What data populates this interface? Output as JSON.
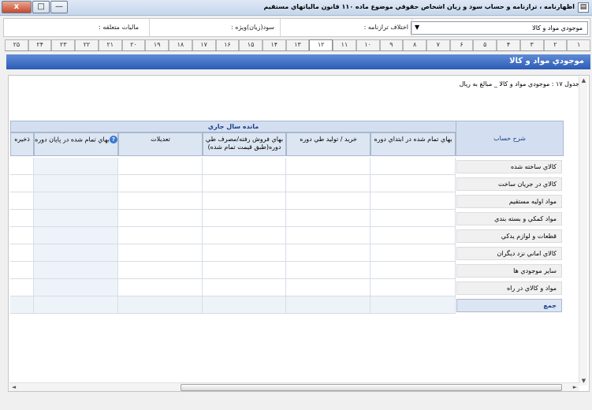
{
  "window": {
    "title": "اظهارنامه ، ترازنامه و حساب سود و زيان اشخاص حقوقي موضوع ماده ۱۱۰ قانون مالياتهاي مستقيم",
    "controls": {
      "close": "x",
      "maximize": "□",
      "minimize": "—"
    }
  },
  "toolbar": {
    "select_value": "موجودي مواد و كالا",
    "difference_label": "اختلاف ترازنامه :",
    "profit_label": "سود(زيان)ويژه :",
    "tax_label": "ماليات متعلقه :"
  },
  "tabs": [
    "۱",
    "۲",
    "۳",
    "۴",
    "۵",
    "۶",
    "۷",
    "۸",
    "۹",
    "۱۰",
    "۱۱",
    "۱۲",
    "۱۳",
    "۱۴",
    "۱۵",
    "۱۶",
    "۱۷",
    "۱۸",
    "۱۹",
    "۲۰",
    "۲۱",
    "۲۲",
    "۲۳",
    "۲۴",
    "۲۵"
  ],
  "active_tab": "۱۲",
  "section": {
    "title": "موجودي مواد و كالا"
  },
  "table": {
    "caption": "جدول ۱۷ : موجودي مواد و كالا _ مبالغ به ريال",
    "group_header": "مانده سال جاري",
    "row_header": "شرح حساب",
    "columns": [
      "بهاي تمام شده در ابتداي دوره",
      "خريد / توليد طي دوره",
      "بهاي فروش رفته/مصرف طي دوره(طبق قيمت تمام شده)",
      "تعديلات",
      "بهاي تمام شده در پايان دوره",
      "ذخيره"
    ],
    "rows": [
      "كالاي ساخته شده",
      "كالاي در جريان ساخت",
      "مواد اوليه مستقيم",
      "مواد كمكي و بسته بندي",
      "قطعات و لوازم يدكي",
      "كالاي اماني نزد ديگران",
      "ساير موجودي ها",
      "مواد و كالاي در راه"
    ],
    "total_label": "جمع",
    "help_icon_text": "?"
  },
  "scrollbars": {
    "up": "▲",
    "down": "▼",
    "left": "◄",
    "right": "►"
  }
}
